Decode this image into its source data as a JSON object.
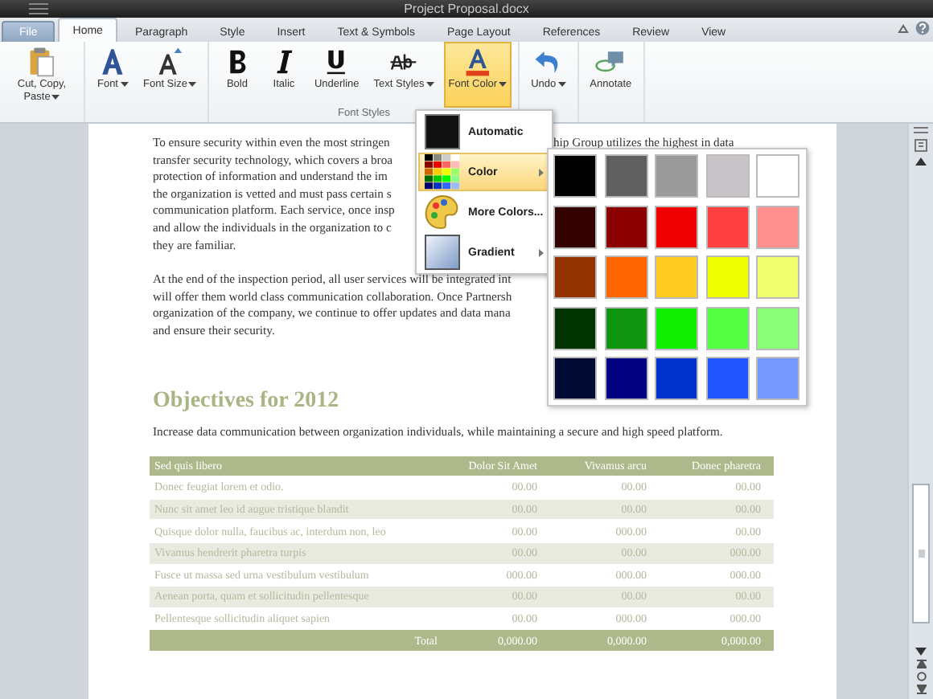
{
  "window": {
    "title": "Project Proposal.docx"
  },
  "tabs": [
    {
      "label": "File",
      "selected": false,
      "kind": "file"
    },
    {
      "label": "Home",
      "selected": true,
      "kind": "tab"
    },
    {
      "label": "Paragraph",
      "selected": false,
      "kind": "tab"
    },
    {
      "label": "Style",
      "selected": false,
      "kind": "tab"
    },
    {
      "label": "Insert",
      "selected": false,
      "kind": "tab"
    },
    {
      "label": "Text & Symbols",
      "selected": false,
      "kind": "tab"
    },
    {
      "label": "Page Layout",
      "selected": false,
      "kind": "tab"
    },
    {
      "label": "References",
      "selected": false,
      "kind": "tab"
    },
    {
      "label": "Review",
      "selected": false,
      "kind": "tab"
    },
    {
      "label": "View",
      "selected": false,
      "kind": "tab"
    }
  ],
  "ribbon": {
    "groups": [
      {
        "items": [
          {
            "label": "Cut, Copy, Paste",
            "dropdown": true,
            "selected": false
          }
        ]
      },
      {
        "items": [
          {
            "label": "Font",
            "dropdown": true,
            "selected": false
          },
          {
            "label": "Font Size",
            "dropdown": true,
            "selected": false
          }
        ]
      },
      {
        "label": "Font Styles",
        "items": [
          {
            "label": "Bold",
            "dropdown": false,
            "selected": false
          },
          {
            "label": "Italic",
            "dropdown": false,
            "selected": false
          },
          {
            "label": "Underline",
            "dropdown": false,
            "selected": false
          },
          {
            "label": "Text Styles",
            "dropdown": true,
            "selected": false
          },
          {
            "label": "Font Color",
            "dropdown": true,
            "selected": true
          }
        ]
      },
      {
        "items": [
          {
            "label": "Undo",
            "dropdown": true,
            "selected": false
          }
        ]
      },
      {
        "items": [
          {
            "label": "Annotate",
            "dropdown": false,
            "selected": false
          }
        ]
      }
    ]
  },
  "document": {
    "paragraphs": [
      {
        "lines": [
          [
            "To ensure security within even the most stringen",
            "hip Group utilizes the highest in data"
          ],
          [
            "transfer security technology, which covers a broa"
          ],
          [
            "protection of information and understand the im"
          ],
          [
            "the organization is vetted and must pass certain s"
          ],
          [
            "communication platform. Each service, once insp"
          ],
          [
            "and allow the individuals in the organization to c"
          ],
          [
            "they are familiar."
          ]
        ]
      },
      {
        "lines": [
          [
            "At the end of the inspection period, all user services will be integrated int"
          ],
          [
            "will offer them world class communication collaboration. Once Partnersh"
          ],
          [
            "organization of the company, we continue to offer updates and data mana"
          ],
          [
            "and ensure their security."
          ]
        ]
      }
    ],
    "heading": "Objectives for 2012",
    "intro": "Increase data communication between organization individuals, while maintaining a secure and high speed platform.",
    "table": {
      "columns": [
        "Sed quis libero",
        "Dolor Sit Amet",
        "Vivamus arcu",
        "Donec pharetra"
      ],
      "rows": [
        [
          "Donec feugiat lorem et odio.",
          "00.00",
          "00.00",
          "00.00"
        ],
        [
          "Nunc sit amet leo id augue tristique blandit",
          "00.00",
          "00.00",
          "00.00"
        ],
        [
          "Quisque dolor nulla, faucibus ac, interdum non, leo",
          "00.00",
          "000.00",
          "00.00"
        ],
        [
          "Vivamus hendrerit pharetra turpis",
          "00.00",
          "00.00",
          "000.00"
        ],
        [
          "Fusce ut massa sed urna vestibulum vestibulum",
          "000.00",
          "000.00",
          "000.00"
        ],
        [
          "Aenean porta, quam et sollicitudin pellentesque",
          "00.00",
          "00.00",
          "00.00"
        ],
        [
          "Pellentesque sollicitudin aliquet sapien",
          "00.00",
          "000.00",
          "000.00"
        ]
      ],
      "total": {
        "label": "Total",
        "values": [
          "0,000.00",
          "0,000.00",
          "0,000.00"
        ]
      }
    }
  },
  "color_menu": {
    "items": [
      {
        "label": "Automatic",
        "selected": false,
        "submenu": false
      },
      {
        "label": "Color",
        "selected": true,
        "submenu": true
      },
      {
        "label": "More Colors...",
        "selected": false,
        "submenu": false
      },
      {
        "label": "Gradient",
        "selected": false,
        "submenu": true
      }
    ]
  },
  "palette": [
    {
      "color": "#000000"
    },
    {
      "color": "#606060"
    },
    {
      "color": "#9a9a9a"
    },
    {
      "color": "#c8c4c8"
    },
    {
      "color": "#ffffff"
    },
    {
      "color": "#330000"
    },
    {
      "color": "#8b0000"
    },
    {
      "color": "#ee0000"
    },
    {
      "color": "#ff4040"
    },
    {
      "color": "#ff9090"
    },
    {
      "color": "#933300"
    },
    {
      "color": "#ff6600"
    },
    {
      "color": "#ffcc22"
    },
    {
      "color": "#eeff00"
    },
    {
      "color": "#eeff70"
    },
    {
      "color": "#003300"
    },
    {
      "color": "#109510"
    },
    {
      "color": "#11ee00"
    },
    {
      "color": "#55ff44"
    },
    {
      "color": "#88ff77"
    },
    {
      "color": "#000a33"
    },
    {
      "color": "#000080"
    },
    {
      "color": "#0033cc"
    },
    {
      "color": "#2255ff"
    },
    {
      "color": "#7799ff"
    }
  ]
}
